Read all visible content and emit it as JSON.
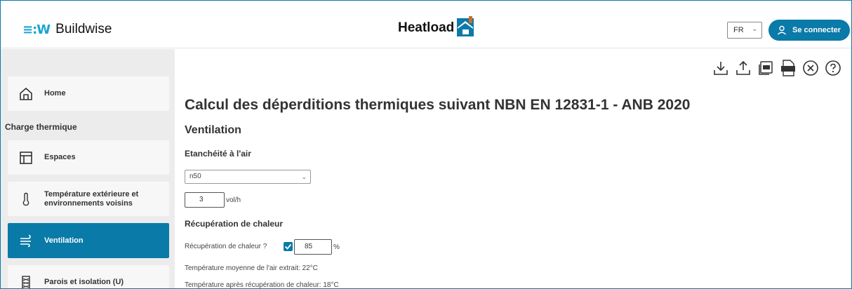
{
  "header": {
    "brand_mark": "≡:W",
    "brand_name": "Buildwise",
    "app_name": "Heatload",
    "language": "FR",
    "login_label": "Se connecter"
  },
  "sidebar": {
    "home_label": "Home",
    "section_title": "Charge thermique",
    "items": [
      {
        "label": "Espaces",
        "icon": "layout-icon"
      },
      {
        "label": "Température extérieure et environnements voisins",
        "icon": "thermometer-icon"
      },
      {
        "label": "Ventilation",
        "icon": "wind-icon",
        "active": true
      },
      {
        "label": "Parois et isolation (U)",
        "icon": "wall-icon"
      }
    ]
  },
  "toolbar": {
    "icons": [
      "download-icon",
      "upload-icon",
      "pdf-icon",
      "docx-icon",
      "close-circle-icon",
      "help-icon"
    ]
  },
  "main": {
    "title": "Calcul des déperditions thermiques suivant NBN EN 12831-1 - ANB 2020",
    "section": "Ventilation",
    "airtightness": {
      "heading": "Etanchéité à l'air",
      "select_value": "n50",
      "value": "3",
      "unit": "vol/h"
    },
    "heat_recovery": {
      "heading": "Récupération de chaleur",
      "question": "Récupération de chaleur ?",
      "checked": true,
      "value": "85",
      "unit": "%",
      "line1": "Température moyenne de l'air extrait: 22°C",
      "line2": "Température après récupération de chaleur: 18°C"
    }
  },
  "colors": {
    "accent": "#0a7aa8",
    "brand": "#19a5d3"
  }
}
